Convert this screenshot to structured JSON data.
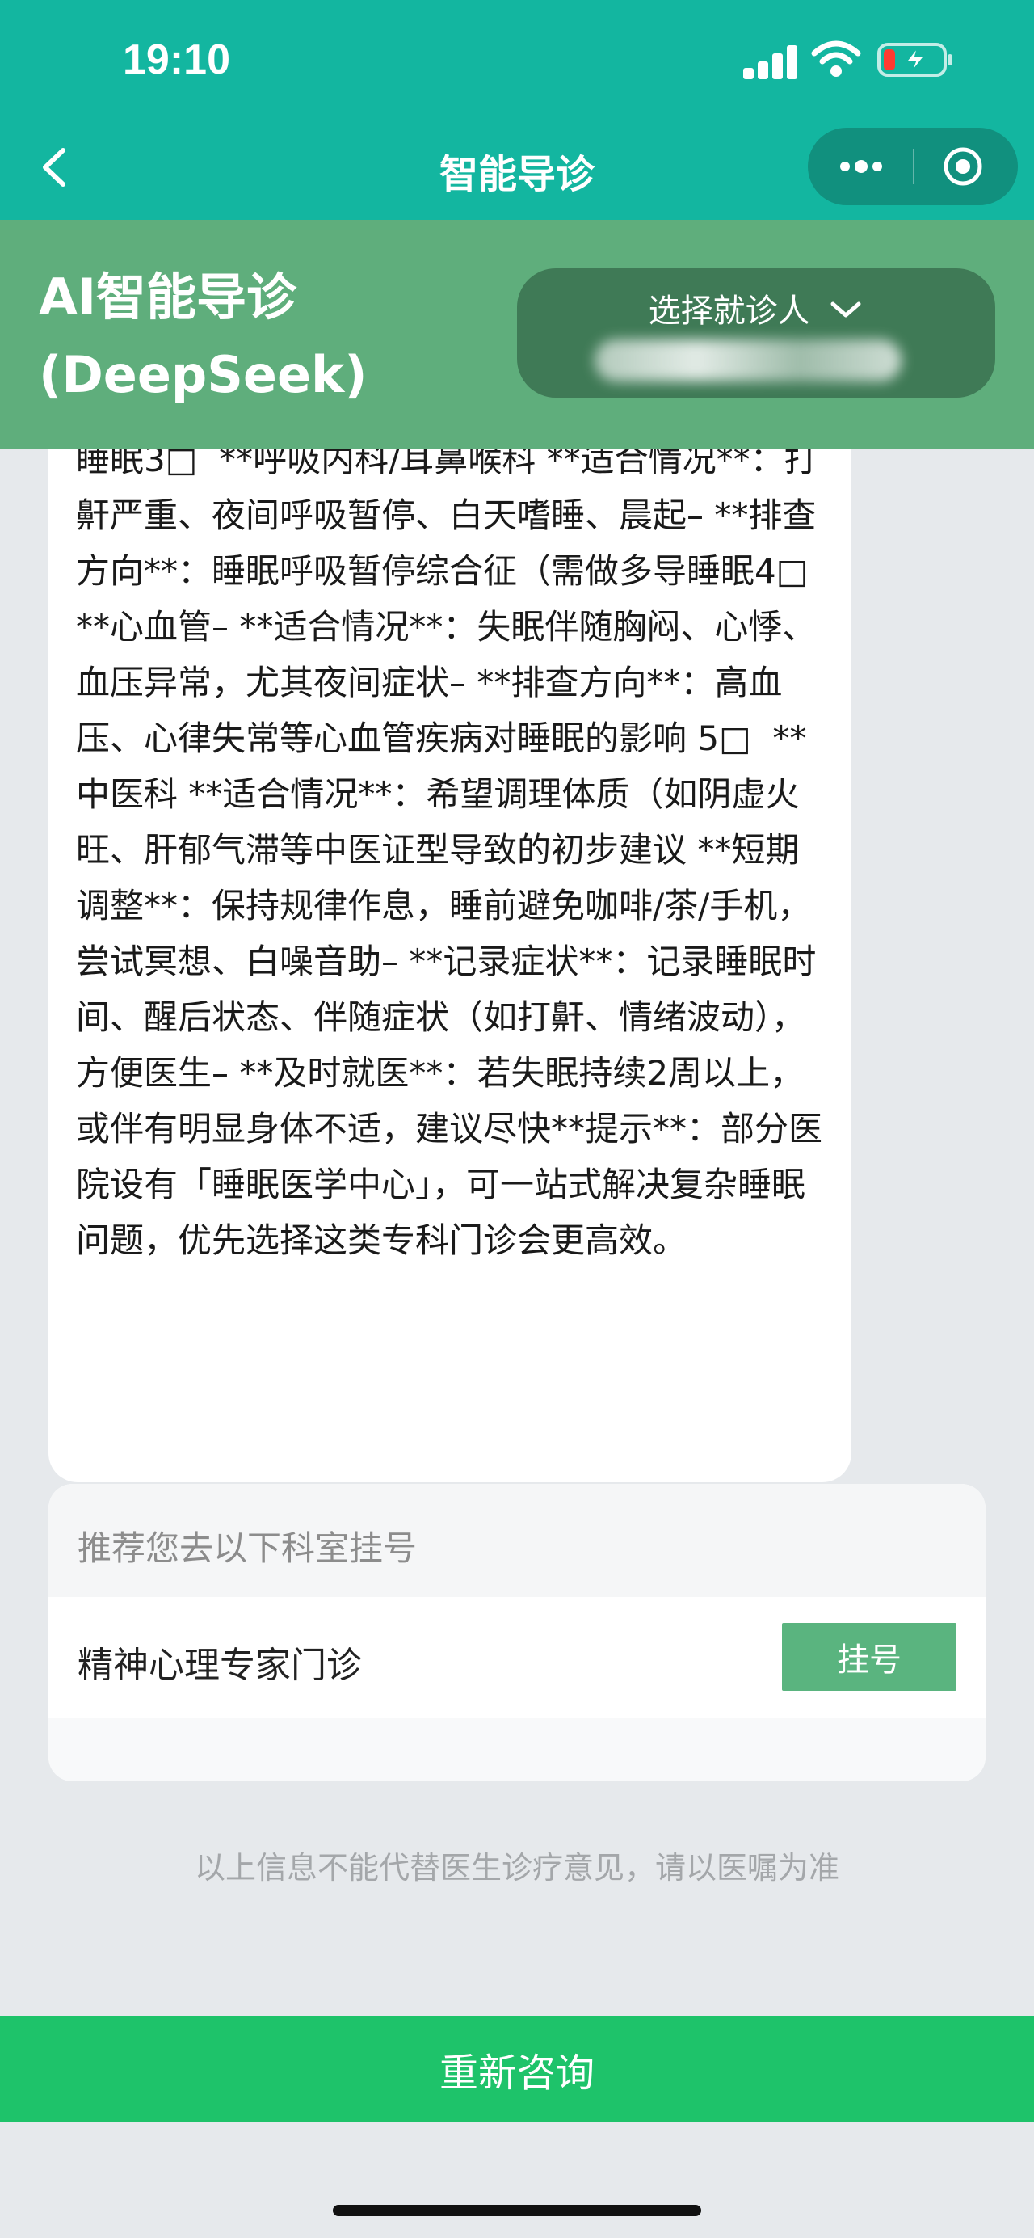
{
  "status_bar": {
    "time": "19:10"
  },
  "nav": {
    "title": "智能导诊"
  },
  "header": {
    "brand_line1": "AI智能导诊",
    "brand_line2": "(DeepSeek)",
    "patient_picker_label": "选择就诊人"
  },
  "answer": {
    "text": "睡眠3□  **呼吸内科/耳鼻喉科 **适合情况**：打鼾严重、夜间呼吸暂停、白天嗜睡、晨起– **排查方向**：睡眠呼吸暂停综合征（需做多导睡眠4□  **心血管– **适合情况**：失眠伴随胸闷、心悸、血压异常，尤其夜间症状– **排查方向**：高血压、心律失常等心血管疾病对睡眠的影响 5□  **中医科 **适合情况**：希望调理体质（如阴虚火旺、肝郁气滞等中医证型导致的初步建议 **短期调整**：保持规律作息，睡前避免咖啡/茶/手机，尝试冥想、白噪音助– **记录症状**：记录睡眠时间、醒后状态、伴随症状（如打鼾、情绪波动），方便医生– **及时就医**：若失眠持续2周以上，或伴有明显身体不适，建议尽快**提示**：部分医院设有「睡眠医学中心」，可一站式解决复杂睡眠问题，优先选择这类专科门诊会更高效。"
  },
  "recommendation": {
    "title": "推荐您去以下科室挂号",
    "departments": [
      {
        "name": "精神心理专家门诊",
        "action_label": "挂号"
      }
    ]
  },
  "disclaimer": "以上信息不能代替医生诊疗意见，请以医嘱为准",
  "footer": {
    "reconsult_label": "重新咨询"
  },
  "colors": {
    "nav_teal": "#13b6a0",
    "header_green": "#5fae7c",
    "register_button": "#5ab47f",
    "reconsult_button": "#1ec36a",
    "page_background": "#e6e9ec"
  },
  "icons": [
    "back-arrow-icon",
    "signal-icon",
    "wifi-icon",
    "battery-charging-icon",
    "more-dots-icon",
    "close-target-icon",
    "chevron-down-icon"
  ]
}
